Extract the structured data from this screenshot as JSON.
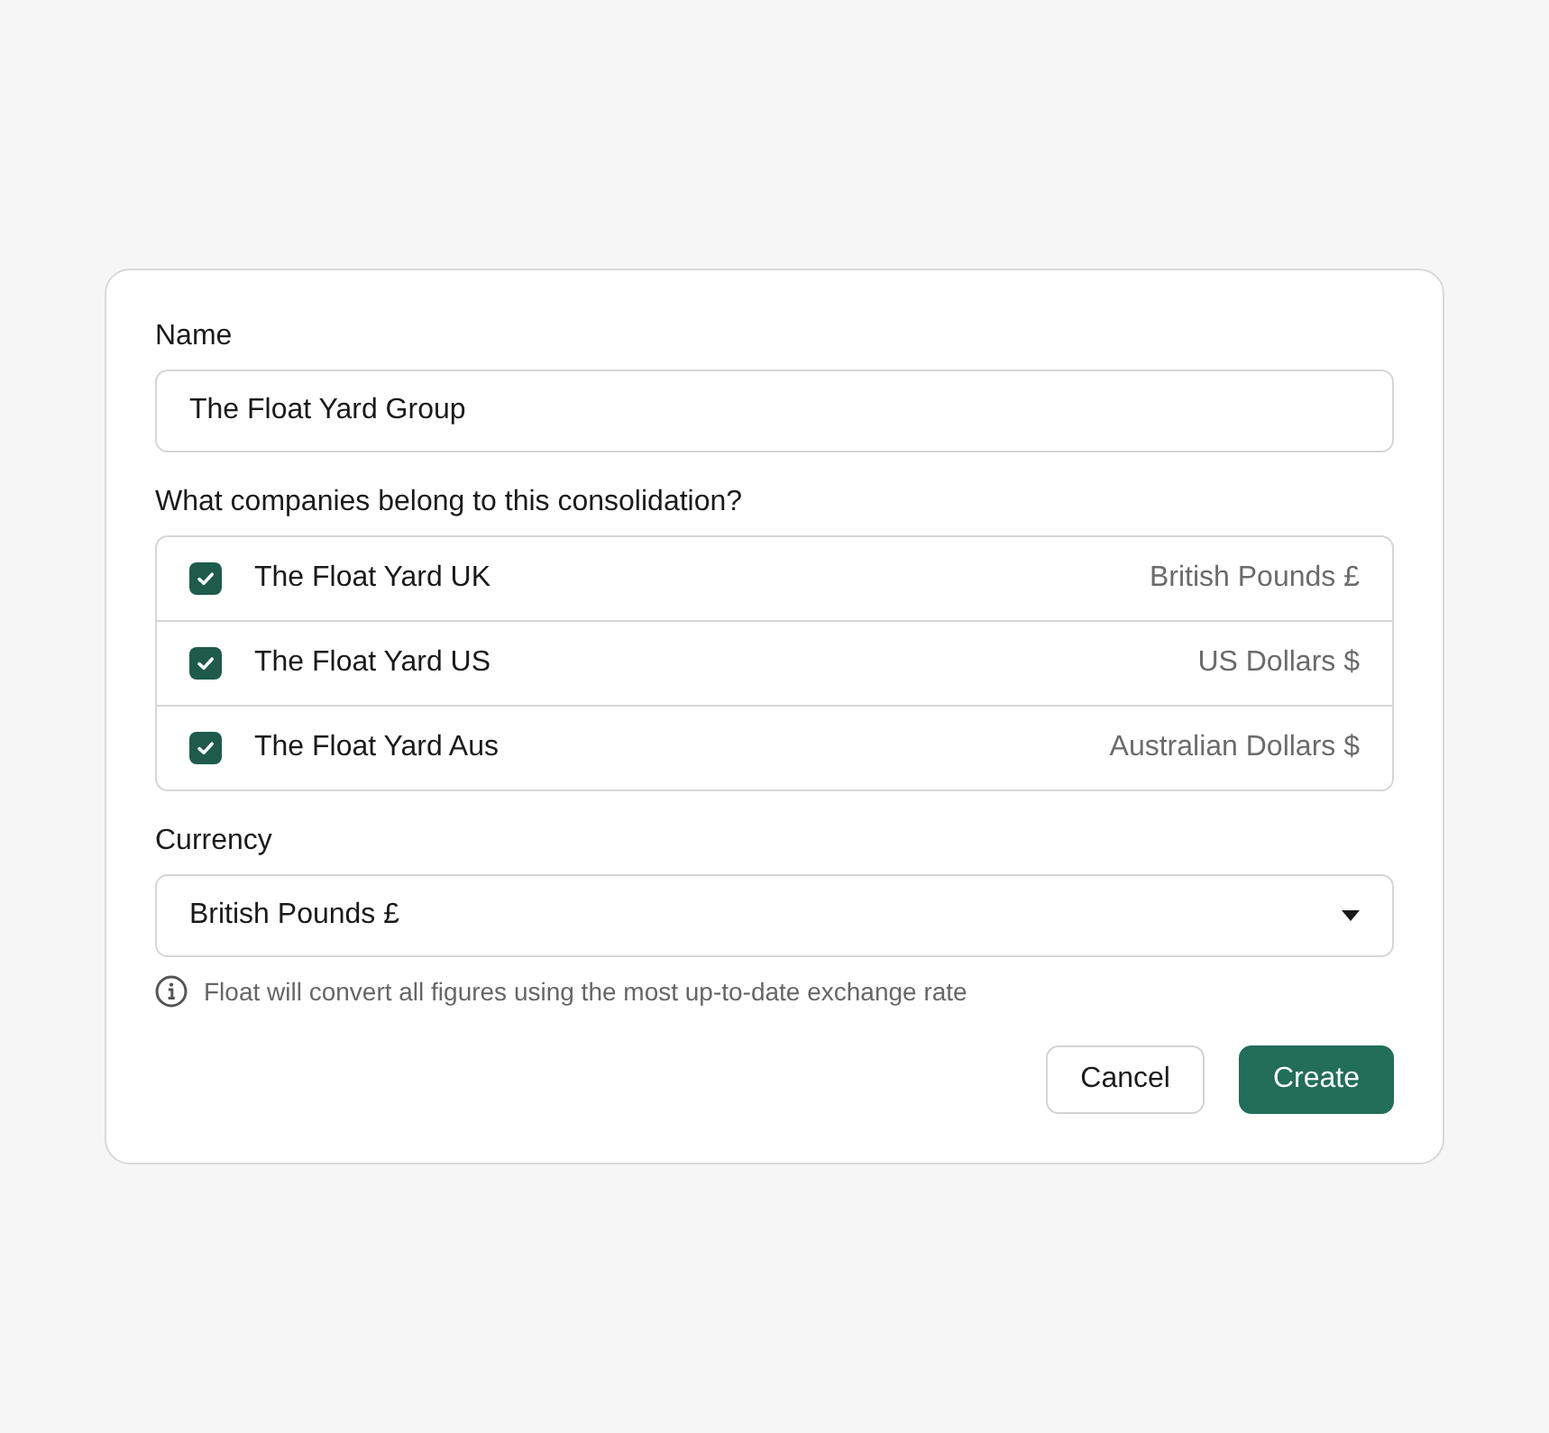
{
  "form": {
    "name_field": {
      "label": "Name",
      "value": "The Float Yard Group"
    },
    "companies": {
      "label": "What companies belong to this consolidation?",
      "items": [
        {
          "name": "The Float Yard UK",
          "currency": "British Pounds £",
          "checked": true
        },
        {
          "name": "The Float Yard US",
          "currency": "US Dollars $",
          "checked": true
        },
        {
          "name": "The Float Yard Aus",
          "currency": "Australian Dollars $",
          "checked": true
        }
      ]
    },
    "currency_field": {
      "label": "Currency",
      "value": "British Pounds £"
    },
    "info_note": "Float will convert all figures using the most up-to-date exchange rate",
    "buttons": [
      {
        "label": "Cancel",
        "kind": "secondary"
      },
      {
        "label": "Create",
        "kind": "primary"
      }
    ]
  }
}
